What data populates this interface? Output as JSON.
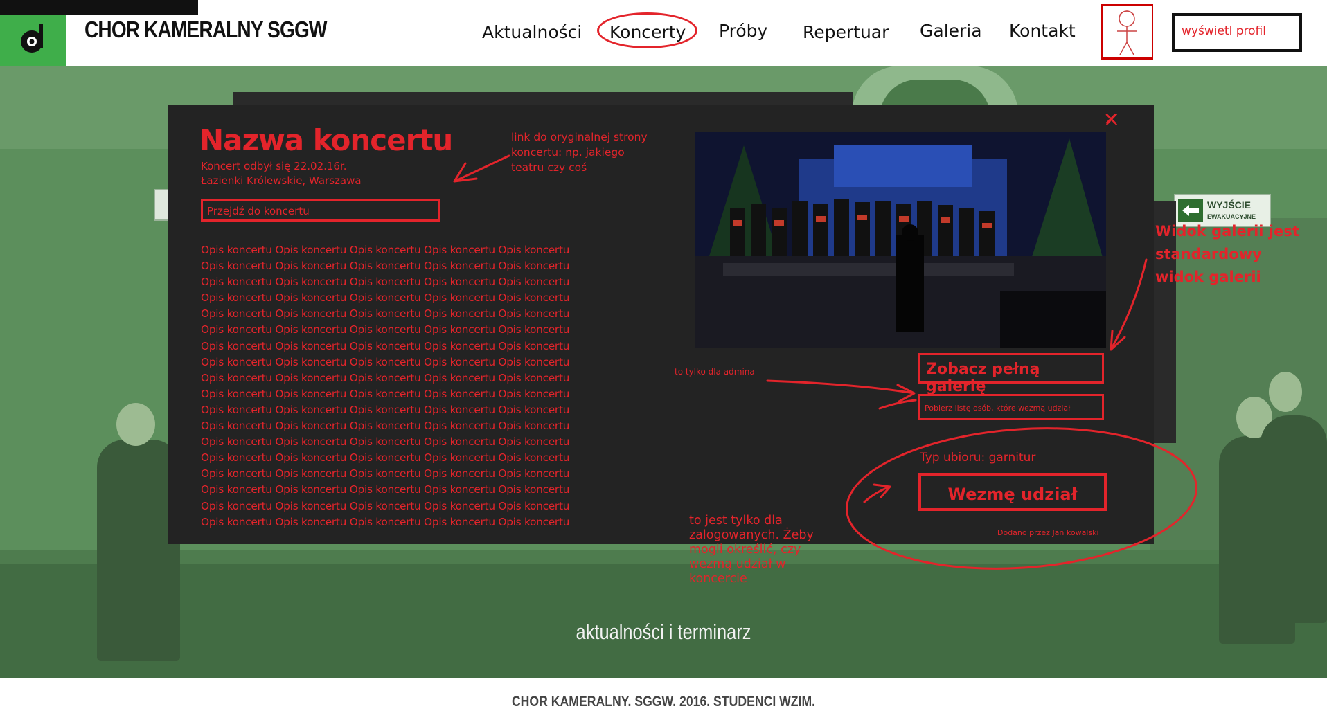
{
  "header": {
    "site_title": "CHOR KAMERALNY SGGW",
    "nav": {
      "aktualnosci": "Aktualności",
      "koncerty": "Koncerty",
      "proby": "Próby",
      "repertuar": "Repertuar",
      "galeria": "Galeria",
      "kontakt": "Kontakt"
    },
    "profile_button": "wyświetl profil"
  },
  "background": {
    "exit_sign": "WYJŚCIE",
    "exit_sign_sub": "EWAKUACYJNE",
    "caption": "aktualności i terminarz"
  },
  "modal": {
    "close": "✕",
    "title": "Nazwa koncertu",
    "date": "Koncert odbył się 22.02.16r.",
    "place": "Łazienki Królewskie, Warszawa",
    "link_button": "Przejdź do koncertu",
    "description_lines": [
      "Opis koncertu Opis koncertu Opis koncertu Opis koncertu Opis koncertu",
      "Opis koncertu Opis koncertu Opis koncertu Opis koncertu Opis koncertu",
      "Opis koncertu Opis koncertu Opis koncertu Opis koncertu Opis koncertu",
      "Opis koncertu Opis koncertu Opis koncertu Opis koncertu Opis koncertu",
      "Opis koncertu Opis koncertu Opis koncertu Opis koncertu Opis koncertu",
      "Opis koncertu Opis koncertu Opis koncertu Opis koncertu Opis koncertu",
      "Opis koncertu Opis koncertu Opis koncertu Opis koncertu Opis koncertu",
      "Opis koncertu Opis koncertu Opis koncertu Opis koncertu Opis koncertu",
      "Opis koncertu Opis koncertu Opis koncertu Opis koncertu Opis koncertu",
      "Opis koncertu Opis koncertu Opis koncertu Opis koncertu Opis koncertu",
      "Opis koncertu Opis koncertu Opis koncertu Opis koncertu Opis koncertu",
      "Opis koncertu Opis koncertu Opis koncertu Opis koncertu Opis koncertu",
      "Opis koncertu Opis koncertu Opis koncertu Opis koncertu Opis koncertu",
      "Opis koncertu Opis koncertu Opis koncertu Opis koncertu Opis koncertu",
      "Opis koncertu Opis koncertu Opis koncertu Opis koncertu Opis koncertu",
      "Opis koncertu Opis koncertu Opis koncertu Opis koncertu Opis koncertu",
      "Opis koncertu Opis koncertu Opis koncertu Opis koncertu Opis koncertu",
      "Opis koncertu Opis koncertu Opis koncertu Opis koncertu Opis koncertu"
    ],
    "gallery_button": "Zobacz pełną galerię",
    "download_button": "Pobierz listę osób, które wezmą udział",
    "attire": "Typ ubioru: garnitur",
    "attend_button": "Wezmę udział",
    "added_by": "Dodano przez Jan kowalski"
  },
  "annotations": {
    "link_note": "link do oryginalnej strony koncertu: np. jakiego teatru czy coś",
    "gallery_note": "Widok galerii jest standardowy widok galerii",
    "admin_note": "to tylko dla admina",
    "logged_note": "to jest tylko dla zalogowanych. Żeby mogli określić, czy wezmą udział w koncercie"
  },
  "footer": {
    "text": "CHOR KAMERALNY. SGGW. 2016. STUDENCI WZIM."
  },
  "colors": {
    "accent_red": "#e3242b",
    "logo_green": "#3fae4a",
    "modal_bg": "#232323",
    "bg_green": "#5c8f5c"
  }
}
